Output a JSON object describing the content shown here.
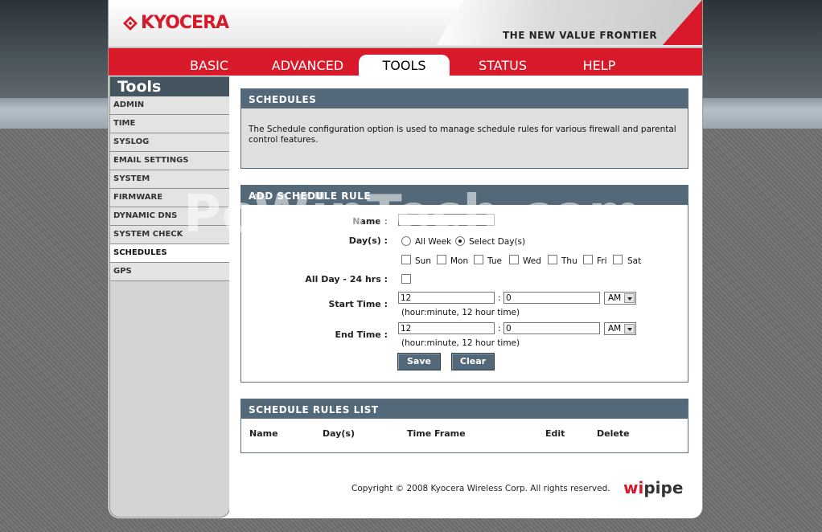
{
  "brand": {
    "logo_text": "KYOCERA",
    "tagline": "THE NEW VALUE FRONTIER",
    "accent": "#d8192a"
  },
  "nav": {
    "tabs": [
      {
        "label": "BASIC"
      },
      {
        "label": "ADVANCED"
      },
      {
        "label": "TOOLS",
        "active": true
      },
      {
        "label": "STATUS"
      },
      {
        "label": "HELP"
      }
    ]
  },
  "sidebar": {
    "title": "Tools",
    "items": [
      {
        "label": "ADMIN"
      },
      {
        "label": "TIME"
      },
      {
        "label": "SYSLOG"
      },
      {
        "label": "EMAIL SETTINGS"
      },
      {
        "label": "SYSTEM"
      },
      {
        "label": "FIRMWARE"
      },
      {
        "label": "DYNAMIC DNS"
      },
      {
        "label": "SYSTEM CHECK"
      },
      {
        "label": "SCHEDULES",
        "active": true
      },
      {
        "label": "GPS"
      }
    ]
  },
  "schedules": {
    "title": "SCHEDULES",
    "description": "The Schedule configuration option is used to manage schedule rules for various firewall and parental control features."
  },
  "add_rule": {
    "title": "ADD SCHEDULE RULE",
    "name_label": "Name :",
    "name_value": "",
    "days_label": "Day(s) :",
    "all_week_label": "All Week",
    "select_days_label": "Select Day(s)",
    "selected_option": "Select Day(s)",
    "days": [
      "Sun",
      "Mon",
      "Tue",
      "Wed",
      "Thu",
      "Fri",
      "Sat"
    ],
    "all_day_label": "All Day - 24 hrs :",
    "start_time_label": "Start Time :",
    "start_hour": "12",
    "start_minute": "0",
    "start_ampm": "AM",
    "end_time_label": "End Time :",
    "end_hour": "12",
    "end_minute": "0",
    "end_ampm": "AM",
    "colon": ":",
    "time_hint": "(hour:minute, 12 hour time)",
    "save_label": "Save",
    "clear_label": "Clear"
  },
  "rules_list": {
    "title": "SCHEDULE RULES LIST",
    "columns": [
      "Name",
      "Day(s)",
      "Time Frame",
      "Edit",
      "Delete"
    ]
  },
  "footer": {
    "copyright": "Copyright © 2008 Kyocera Wireless Corp. All rights reserved.",
    "logo_w": "wi",
    "logo_rest": "pipe"
  },
  "watermark": "PcWinTech.com"
}
